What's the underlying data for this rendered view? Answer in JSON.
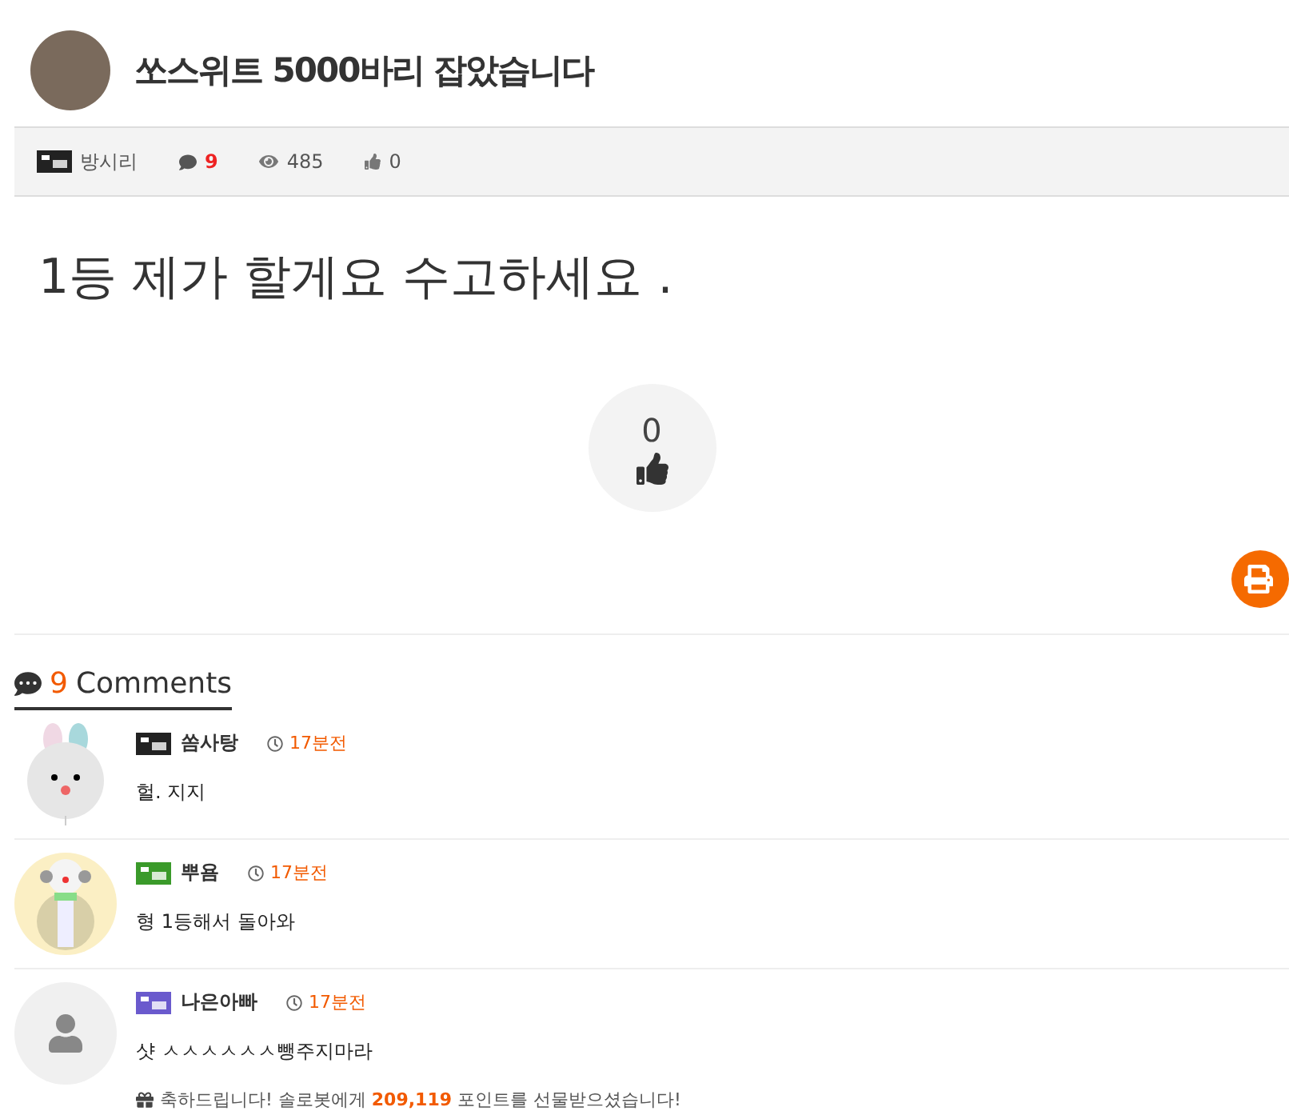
{
  "post": {
    "title": "쏘스위트 5000바리 잡았습니다",
    "author": "방시리",
    "comment_count": "9",
    "views": "485",
    "likes": "0",
    "body": "1등 제가 할게요 수고하세요 .",
    "like_count": "0"
  },
  "comments_header": {
    "count": "9",
    "label": "Comments"
  },
  "comments": [
    {
      "kind": "bunny",
      "color": "#222222",
      "nickname": "쏨사탕",
      "time": "17분전",
      "text": "헐. 지지"
    },
    {
      "kind": "snowman",
      "color": "#3a9a2a",
      "nickname": "뿌욤",
      "time": "17분전",
      "text": "형 1등해서 돌아와"
    },
    {
      "kind": "default",
      "color": "#6a5acd",
      "nickname": "나은아빠",
      "time": "17분전",
      "text": "샷 ㅅㅅㅅㅅㅅㅅ뺑주지마라",
      "notice": "축하드립니다! 솔로봇에게 **209,119** 포인트를 선물받으셨습니다!"
    }
  ]
}
